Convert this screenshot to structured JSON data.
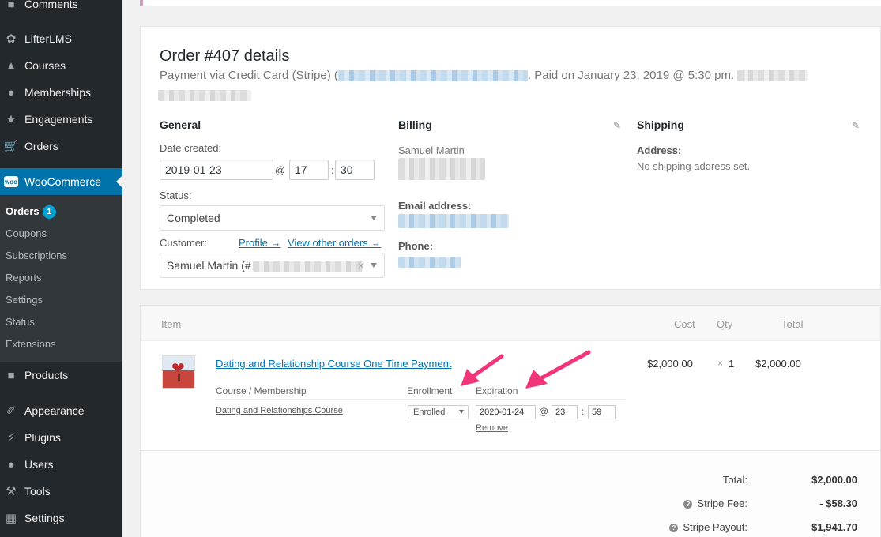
{
  "sidebar": {
    "top_items": [
      {
        "label": "Comments",
        "icon": "comments-icon"
      },
      {
        "label": "LifterLMS",
        "icon": "lifterlms-icon"
      },
      {
        "label": "Courses",
        "icon": "courses-icon"
      },
      {
        "label": "Memberships",
        "icon": "memberships-icon"
      },
      {
        "label": "Engagements",
        "icon": "engagements-icon"
      },
      {
        "label": "Orders",
        "icon": "cart-icon"
      }
    ],
    "woocommerce": {
      "label": "WooCommerce",
      "icon_text": "woo"
    },
    "submenu": [
      {
        "label": "Orders",
        "badge": "1"
      },
      {
        "label": "Coupons"
      },
      {
        "label": "Subscriptions"
      },
      {
        "label": "Reports"
      },
      {
        "label": "Settings"
      },
      {
        "label": "Status"
      },
      {
        "label": "Extensions"
      }
    ],
    "bottom_items": [
      {
        "label": "Products"
      },
      {
        "label": "Appearance"
      },
      {
        "label": "Plugins"
      },
      {
        "label": "Users"
      },
      {
        "label": "Tools"
      },
      {
        "label": "Settings"
      }
    ]
  },
  "order": {
    "title": "Order #407 details",
    "meta_prefix": "Payment via Credit Card (Stripe) (",
    "meta_paid": ". Paid on January 23, 2019 @ 5:30 pm.",
    "general": {
      "heading": "General",
      "date_label": "Date created:",
      "date": "2019-01-23",
      "at": "@",
      "hour": "17",
      "colon": ":",
      "minute": "30",
      "status_label": "Status:",
      "status": "Completed",
      "customer_label": "Customer:",
      "profile_link": "Profile →",
      "other_orders_link": "View other orders →",
      "customer": "Samuel Martin (#",
      "clear": "×"
    },
    "billing": {
      "heading": "Billing",
      "name": "Samuel Martin",
      "email_label": "Email address:",
      "phone_label": "Phone:"
    },
    "shipping": {
      "heading": "Shipping",
      "address_label": "Address:",
      "address": "No shipping address set."
    }
  },
  "items": {
    "headers": {
      "item": "Item",
      "cost": "Cost",
      "qty": "Qty",
      "total": "Total"
    },
    "row": {
      "name": "Dating and Relationship Course One Time Payment",
      "cost": "$2,000.00",
      "qty_x": "×",
      "qty": "1",
      "total": "$2,000.00"
    },
    "sub": {
      "col_course": "Course / Membership",
      "col_enrollment": "Enrollment",
      "col_expiration": "Expiration",
      "course": "Dating and Relationships Course",
      "enrollment": "Enrolled",
      "exp_date": "2020-01-24",
      "exp_at": "@",
      "exp_hour": "23",
      "exp_colon": ":",
      "exp_minute": "59",
      "remove": "Remove"
    },
    "totals": [
      {
        "label": "Total:",
        "value": "$2,000.00",
        "help": false
      },
      {
        "label": "Stripe Fee:",
        "value": "- $58.30",
        "help": true
      },
      {
        "label": "Stripe Payout:",
        "value": "$1,941.70",
        "help": true
      }
    ]
  },
  "colors": {
    "accent": "#0073aa",
    "sidebar": "#23282d",
    "arrow": "#f0357a"
  }
}
